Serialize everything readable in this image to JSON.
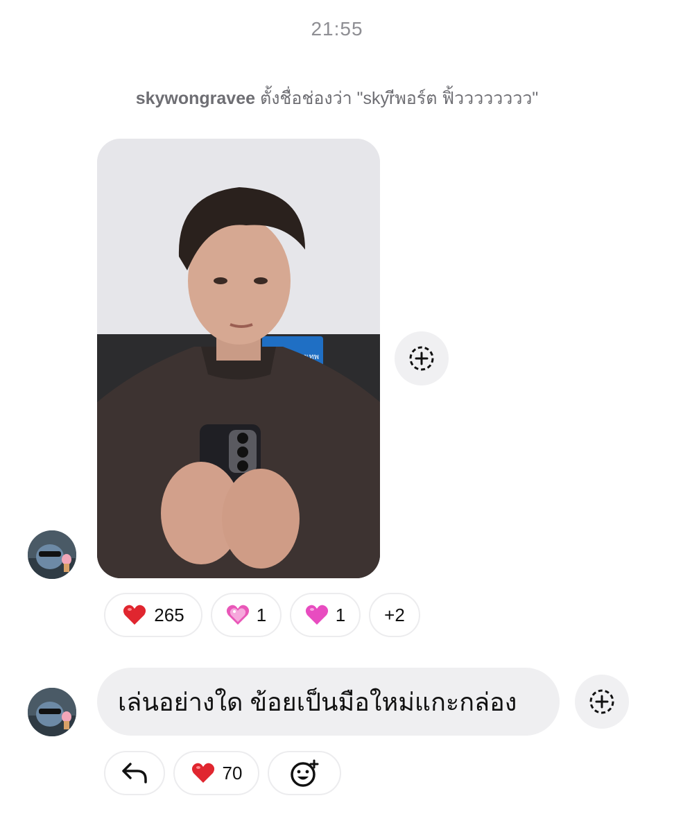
{
  "timestamp": "21:55",
  "system_message": {
    "username": "skywongravee",
    "text": " ตั้งชื่อช่องว่า \"skyrีพอร์ต ฟิ้วววววววว\""
  },
  "messages": [
    {
      "type": "photo",
      "sign_text": "ธนาคารกรุงเทพ",
      "reactions": [
        {
          "emoji": "red-heart",
          "count": "265"
        },
        {
          "emoji": "sparkling-heart",
          "count": "1"
        },
        {
          "emoji": "pink-heart",
          "count": "1"
        },
        {
          "emoji": "more",
          "count": "+2"
        }
      ]
    },
    {
      "type": "text",
      "text": "เล่นอย่างใด ข้อยเป็นมือใหม่แกะกล่อง",
      "reactions": [
        {
          "emoji": "reply-icon",
          "count": ""
        },
        {
          "emoji": "red-heart",
          "count": "70"
        },
        {
          "emoji": "add-reaction-icon",
          "count": ""
        }
      ]
    }
  ],
  "colors": {
    "bubble_bg": "#efeff1",
    "heart_red": "#e0262f",
    "heart_pink": "#e84cc0",
    "muted_text": "#6e6e73"
  }
}
